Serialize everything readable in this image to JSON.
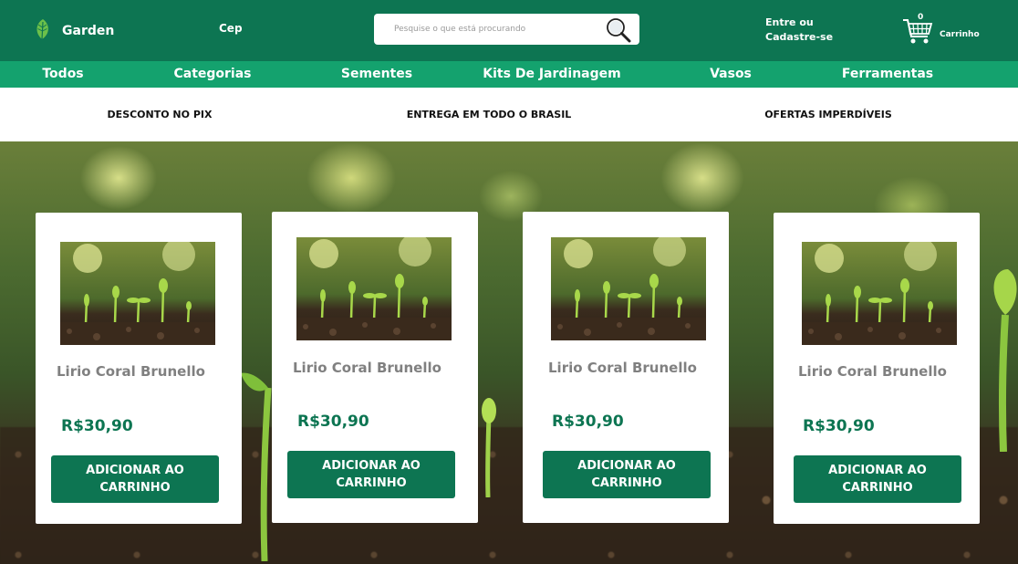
{
  "header": {
    "brand": "Garden",
    "cep_label": "Cep",
    "search_placeholder": "Pesquise o que está procurando",
    "login_line1": "Entre ou",
    "login_line2": "Cadastre-se",
    "cart_count": "0",
    "cart_label": "Carrinho"
  },
  "nav": {
    "items": [
      "Todos",
      "Categorias",
      "Sementes",
      "Kits De Jardinagem",
      "Vasos",
      "Ferramentas"
    ]
  },
  "benefits": [
    "DESCONTO NO PIX",
    "ENTREGA EM TODO O BRASIL",
    "OFERTAS IMPERDÍVEIS"
  ],
  "products": [
    {
      "name": "Lirio Coral Brunello",
      "price": "R$30,90",
      "button": "ADICIONAR AO CARRINHO"
    },
    {
      "name": "Lirio Coral Brunello",
      "price": "R$30,90",
      "button": "ADICIONAR AO CARRINHO"
    },
    {
      "name": "Lirio Coral Brunello",
      "price": "R$30,90",
      "button": "ADICIONAR AO CARRINHO"
    },
    {
      "name": "Lirio Coral Brunello",
      "price": "R$30,90",
      "button": "ADICIONAR AO CARRINHO"
    }
  ],
  "colors": {
    "header_bg": "#0d7552",
    "nav_bg": "#14a26e",
    "price": "#0d7552",
    "button_bg": "#0d7552",
    "product_name": "#808080"
  }
}
